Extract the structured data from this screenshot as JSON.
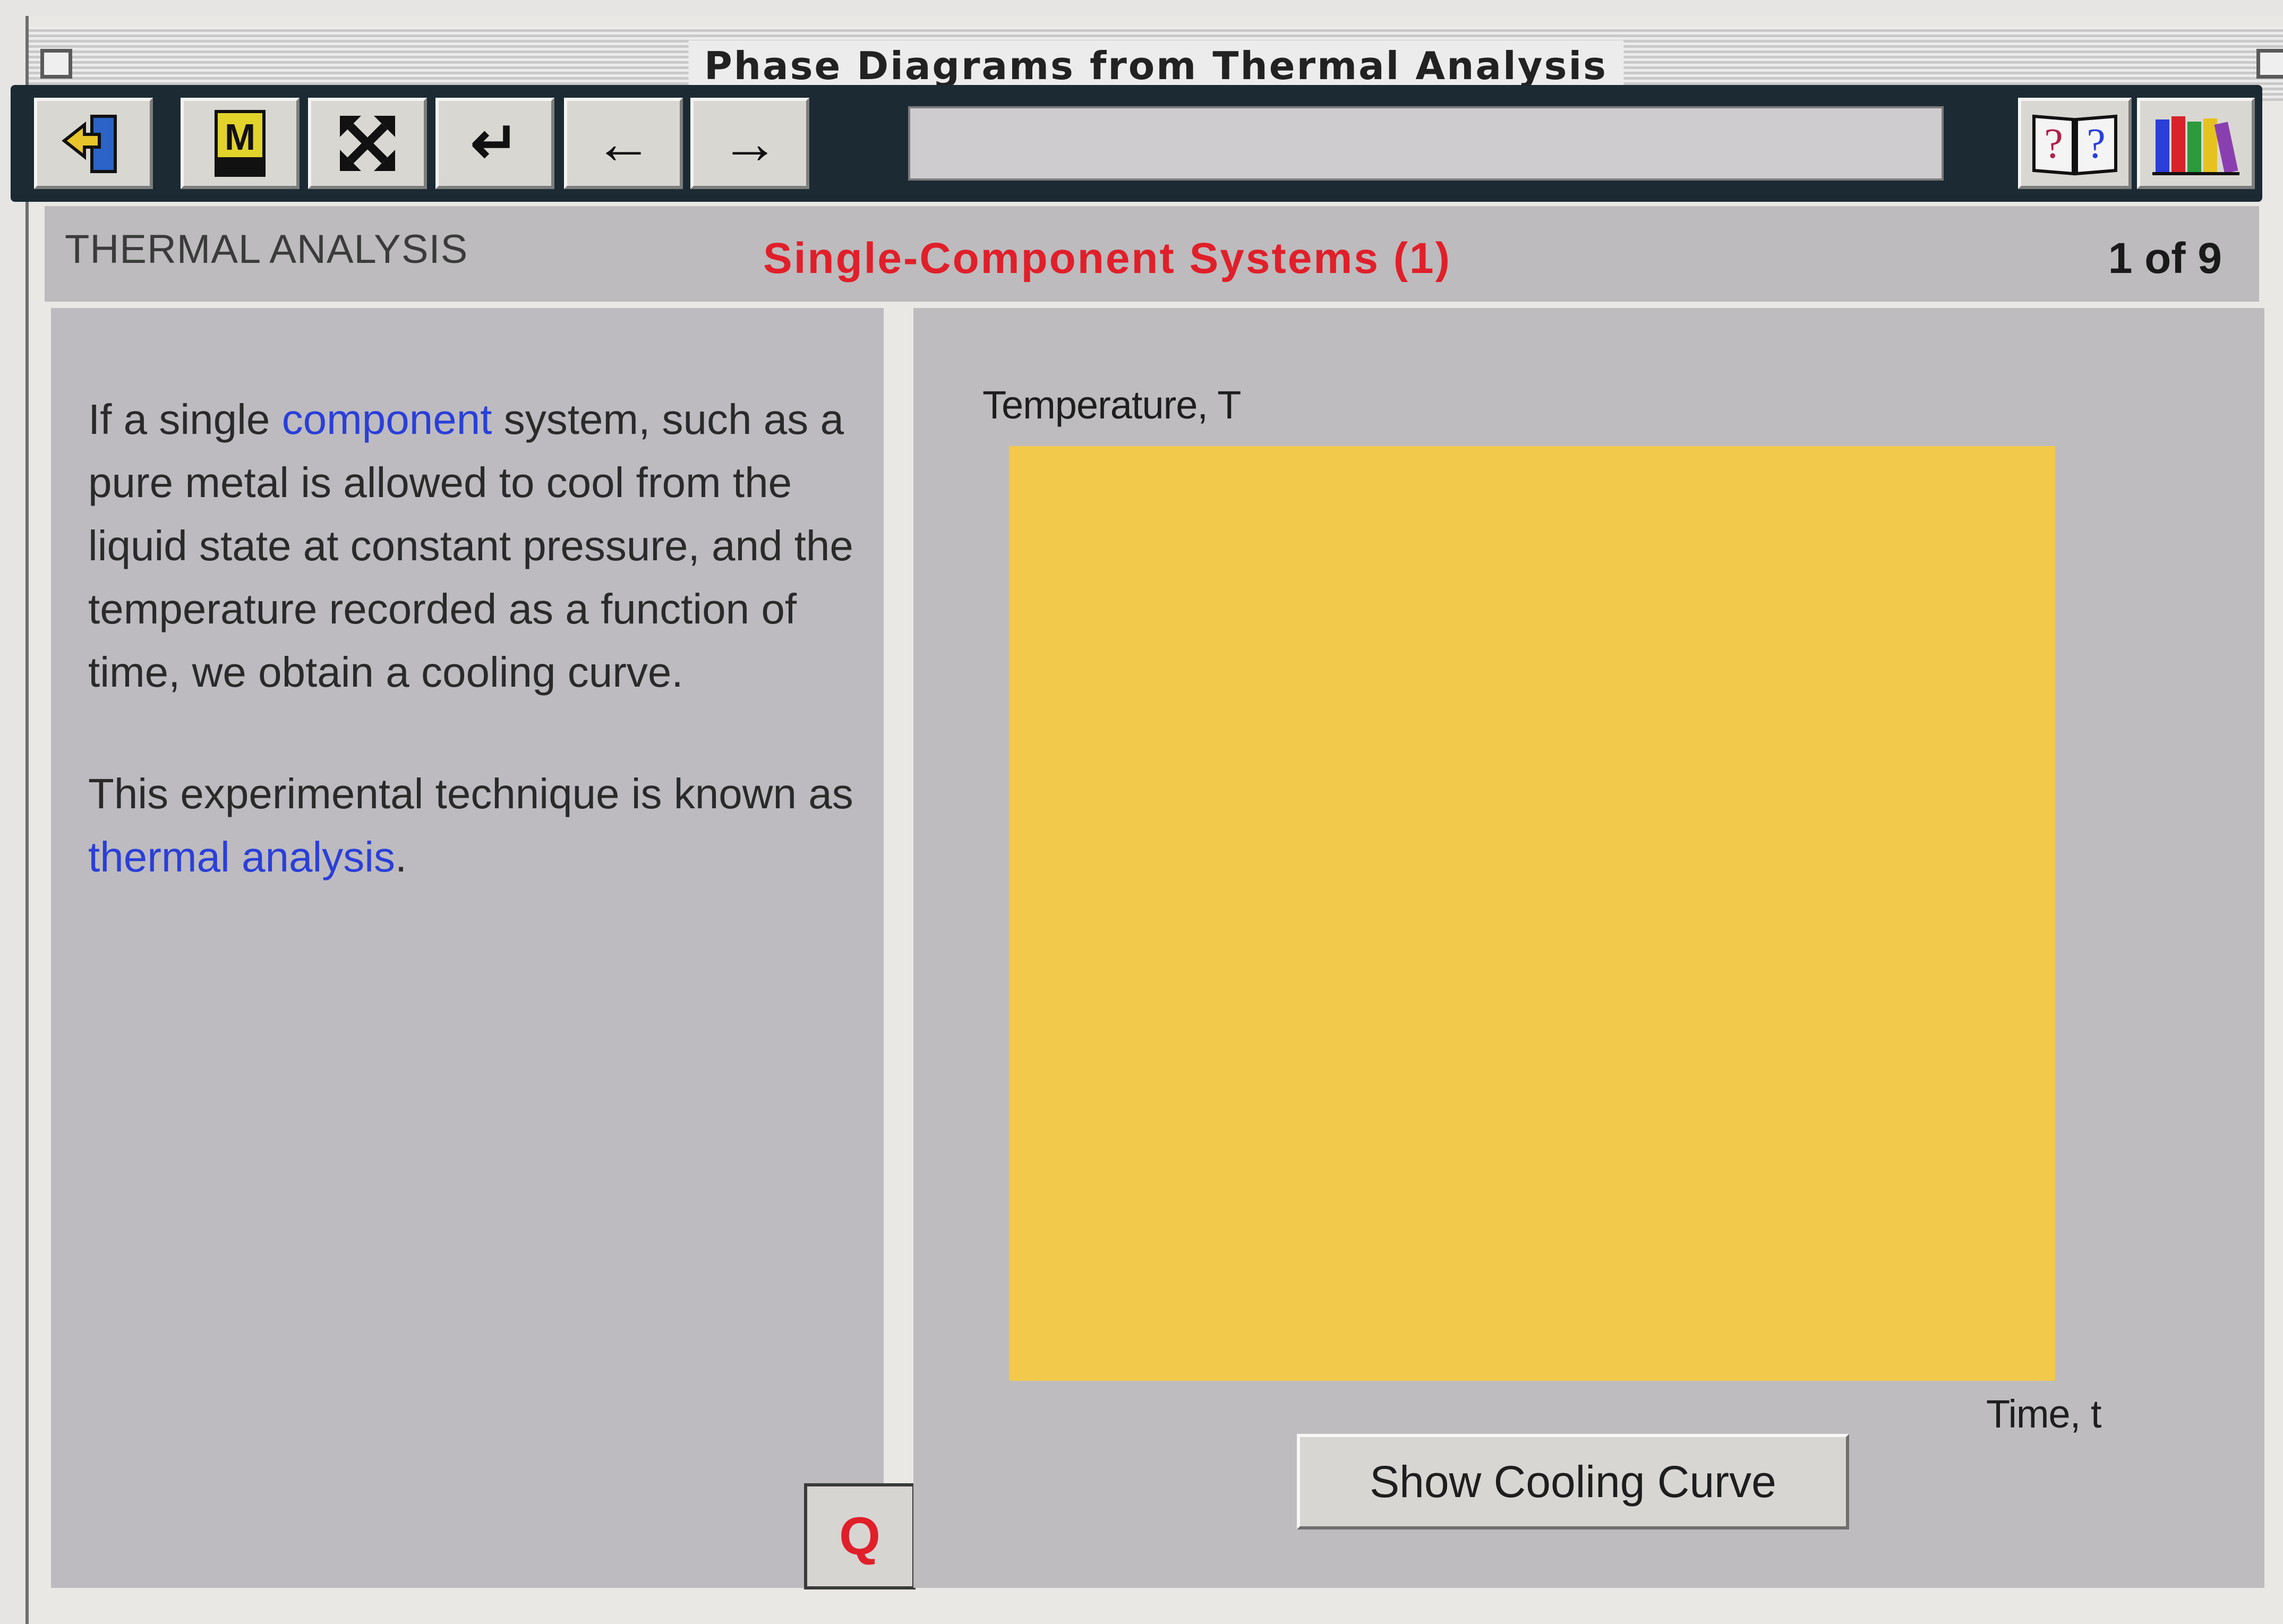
{
  "window": {
    "title": "Phase Diagrams from Thermal Analysis"
  },
  "toolbar": {
    "buttons": [
      {
        "name": "exit",
        "icon": "exit-door-icon",
        "glyph": "⇦"
      },
      {
        "name": "map",
        "icon": "map-icon",
        "glyph": "M"
      },
      {
        "name": "expand",
        "icon": "expand-arrows-icon",
        "glyph": "✕"
      },
      {
        "name": "return",
        "icon": "return-arrow-icon",
        "glyph": "↵"
      },
      {
        "name": "back",
        "icon": "left-arrow-icon",
        "glyph": "←"
      },
      {
        "name": "forward",
        "icon": "right-arrow-icon",
        "glyph": "→"
      }
    ],
    "address_value": "",
    "help": {
      "icon": "help-book-icon",
      "glyph": "??"
    },
    "library": {
      "icon": "library-books-icon"
    }
  },
  "header": {
    "section": "THERMAL ANALYSIS",
    "title": "Single-Component Systems (1)",
    "counter": "1 of 9"
  },
  "text_panel": {
    "p1_before": "If a single ",
    "p1_link": "component",
    "p1_after": " system, such as a pure metal is allowed to cool from the liquid state at constant pressure, and the temperature recorded as a function of time, we obtain a cooling curve.",
    "p2_before": "This experimental technique is known as ",
    "p2_link": "thermal analysis",
    "p2_after": ".",
    "q_button": "Q"
  },
  "graph": {
    "y_label": "Temperature, T",
    "x_label": "Time, t",
    "button": "Show Cooling Curve"
  },
  "colors": {
    "title_red": "#e01f2a",
    "link_blue": "#2a3fd8",
    "plot_yellow": "#f2c94a",
    "toolbar_dark": "#1b2a33"
  }
}
